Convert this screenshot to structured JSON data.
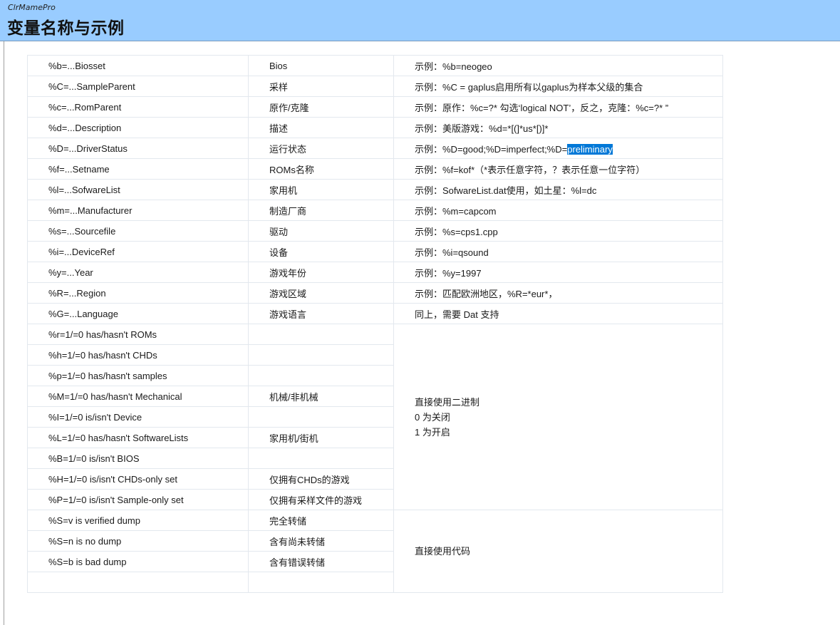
{
  "header": {
    "app_name": "ClrMamePro",
    "title": "变量名称与示例"
  },
  "rows": [
    {
      "code": "%b=...Biosset",
      "meaning": "Bios",
      "example": "示例：%b=neogeo"
    },
    {
      "code": "%C=...SampleParent",
      "meaning": "采样",
      "example": "示例：%C = gaplus启用所有以gaplus为样本父级的集合"
    },
    {
      "code": "%c=...RomParent",
      "meaning": "原作/克隆",
      "example": "示例：原作：%c=?* 勾选‘logical NOT’，反之，克隆：%c=?* ”"
    },
    {
      "code": "%d=...Description",
      "meaning": "描述",
      "example": "示例：美版游戏：%d=*[(]*us*[)]*"
    },
    {
      "code": "%D=...DriverStatus",
      "meaning": "运行状态",
      "example": "示例：%D=good;%D=imperfect;%D=",
      "example_selected": "preliminary"
    },
    {
      "code": "%f=...Setname",
      "meaning": "ROMs名称",
      "example": "示例：%f=kof*（*表示任意字符，？表示任意一位字符）"
    },
    {
      "code": "%l=...SofwareList",
      "meaning": "家用机",
      "example": "示例：SofwareList.dat使用，如土星：%l=dc"
    },
    {
      "code": "%m=...Manufacturer",
      "meaning": "制造厂商",
      "example": "示例：%m=capcom"
    },
    {
      "code": "%s=...Sourcefile",
      "meaning": "驱动",
      "example": "示例：%s=cps1.cpp"
    },
    {
      "code": "%i=...DeviceRef",
      "meaning": "设备",
      "example": "示例：%i=qsound"
    },
    {
      "code": "%y=...Year",
      "meaning": "游戏年份",
      "example": "示例：%y=1997"
    },
    {
      "code": "%R=...Region",
      "meaning": " 游戏区域",
      "example": "示例：匹配欧洲地区，%R=*eur*，"
    },
    {
      "code": "%G=...Language",
      "meaning": " 游戏语言",
      "example": "同上，需要 Dat 支持"
    }
  ],
  "flag_rows": [
    {
      "code": "%r=1/=0 has/hasn't ROMs",
      "meaning": ""
    },
    {
      "code": "%h=1/=0 has/hasn't CHDs",
      "meaning": ""
    },
    {
      "code": "%p=1/=0 has/hasn't samples",
      "meaning": ""
    },
    {
      "code": "%M=1/=0 has/hasn't Mechanical",
      "meaning": "机械/非机械"
    },
    {
      "code": "%I=1/=0 is/isn't Device",
      "meaning": ""
    },
    {
      "code": "%L=1/=0 has/hasn't SoftwareLists",
      "meaning": "家用机/街机"
    },
    {
      "code": "%B=1/=0 is/isn't BIOS",
      "meaning": ""
    },
    {
      "code": "%H=1/=0 is/isn't CHDs-only set",
      "meaning": "仅拥有CHDs的游戏"
    },
    {
      "code": "%P=1/=0 is/isn't Sample-only set",
      "meaning": "仅拥有采样文件的游戏"
    }
  ],
  "flag_note": [
    "直接使用二进制",
    "0 为关闭",
    "1 为开启"
  ],
  "status_rows": [
    {
      "code": "%S=v is verified dump",
      "meaning": "完全转储"
    },
    {
      "code": "%S=n is no dump",
      "meaning": "含有尚未转储"
    },
    {
      "code": "%S=b is bad dump",
      "meaning": "含有错误转储"
    },
    {
      "code": "",
      "meaning": ""
    }
  ],
  "status_note": "直接使用代码"
}
